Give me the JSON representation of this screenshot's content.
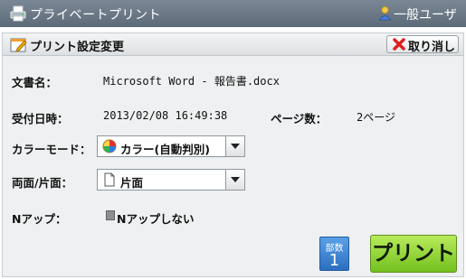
{
  "titlebar": {
    "title": "プライベートプリント",
    "user": "一般ユーザー",
    "icon": "printer-icon",
    "user_icon": "user-icon"
  },
  "header": {
    "title": "プリント設定変更",
    "icon": "settings-edit-icon",
    "cancel_label": "取り消し",
    "cancel_icon": "red-x-icon"
  },
  "document": {
    "label": "文書名：",
    "value": "Microsoft Word - 報告書.docx"
  },
  "received": {
    "label": "受付日時：",
    "value": "2013/02/08 16:49:38"
  },
  "pages": {
    "label": "ページ数：",
    "value": "2ページ"
  },
  "color_mode": {
    "label": "カラーモード：",
    "value": "カラー(自動判別)",
    "icon": "color-palette-icon"
  },
  "duplex": {
    "label": "両面/片面：",
    "value": "片面",
    "icon": "single-sided-icon"
  },
  "nup": {
    "label": "Nアップ：",
    "value": "Nアップしない",
    "icon": "nup-icon"
  },
  "copies": {
    "label": "部数",
    "value": "1"
  },
  "print_label": "プリント",
  "colors": {
    "titlebar": "#5d6b78",
    "print_button": "#8fd334",
    "copies": "#2c6fc0",
    "cancel_x": "#e02020"
  }
}
